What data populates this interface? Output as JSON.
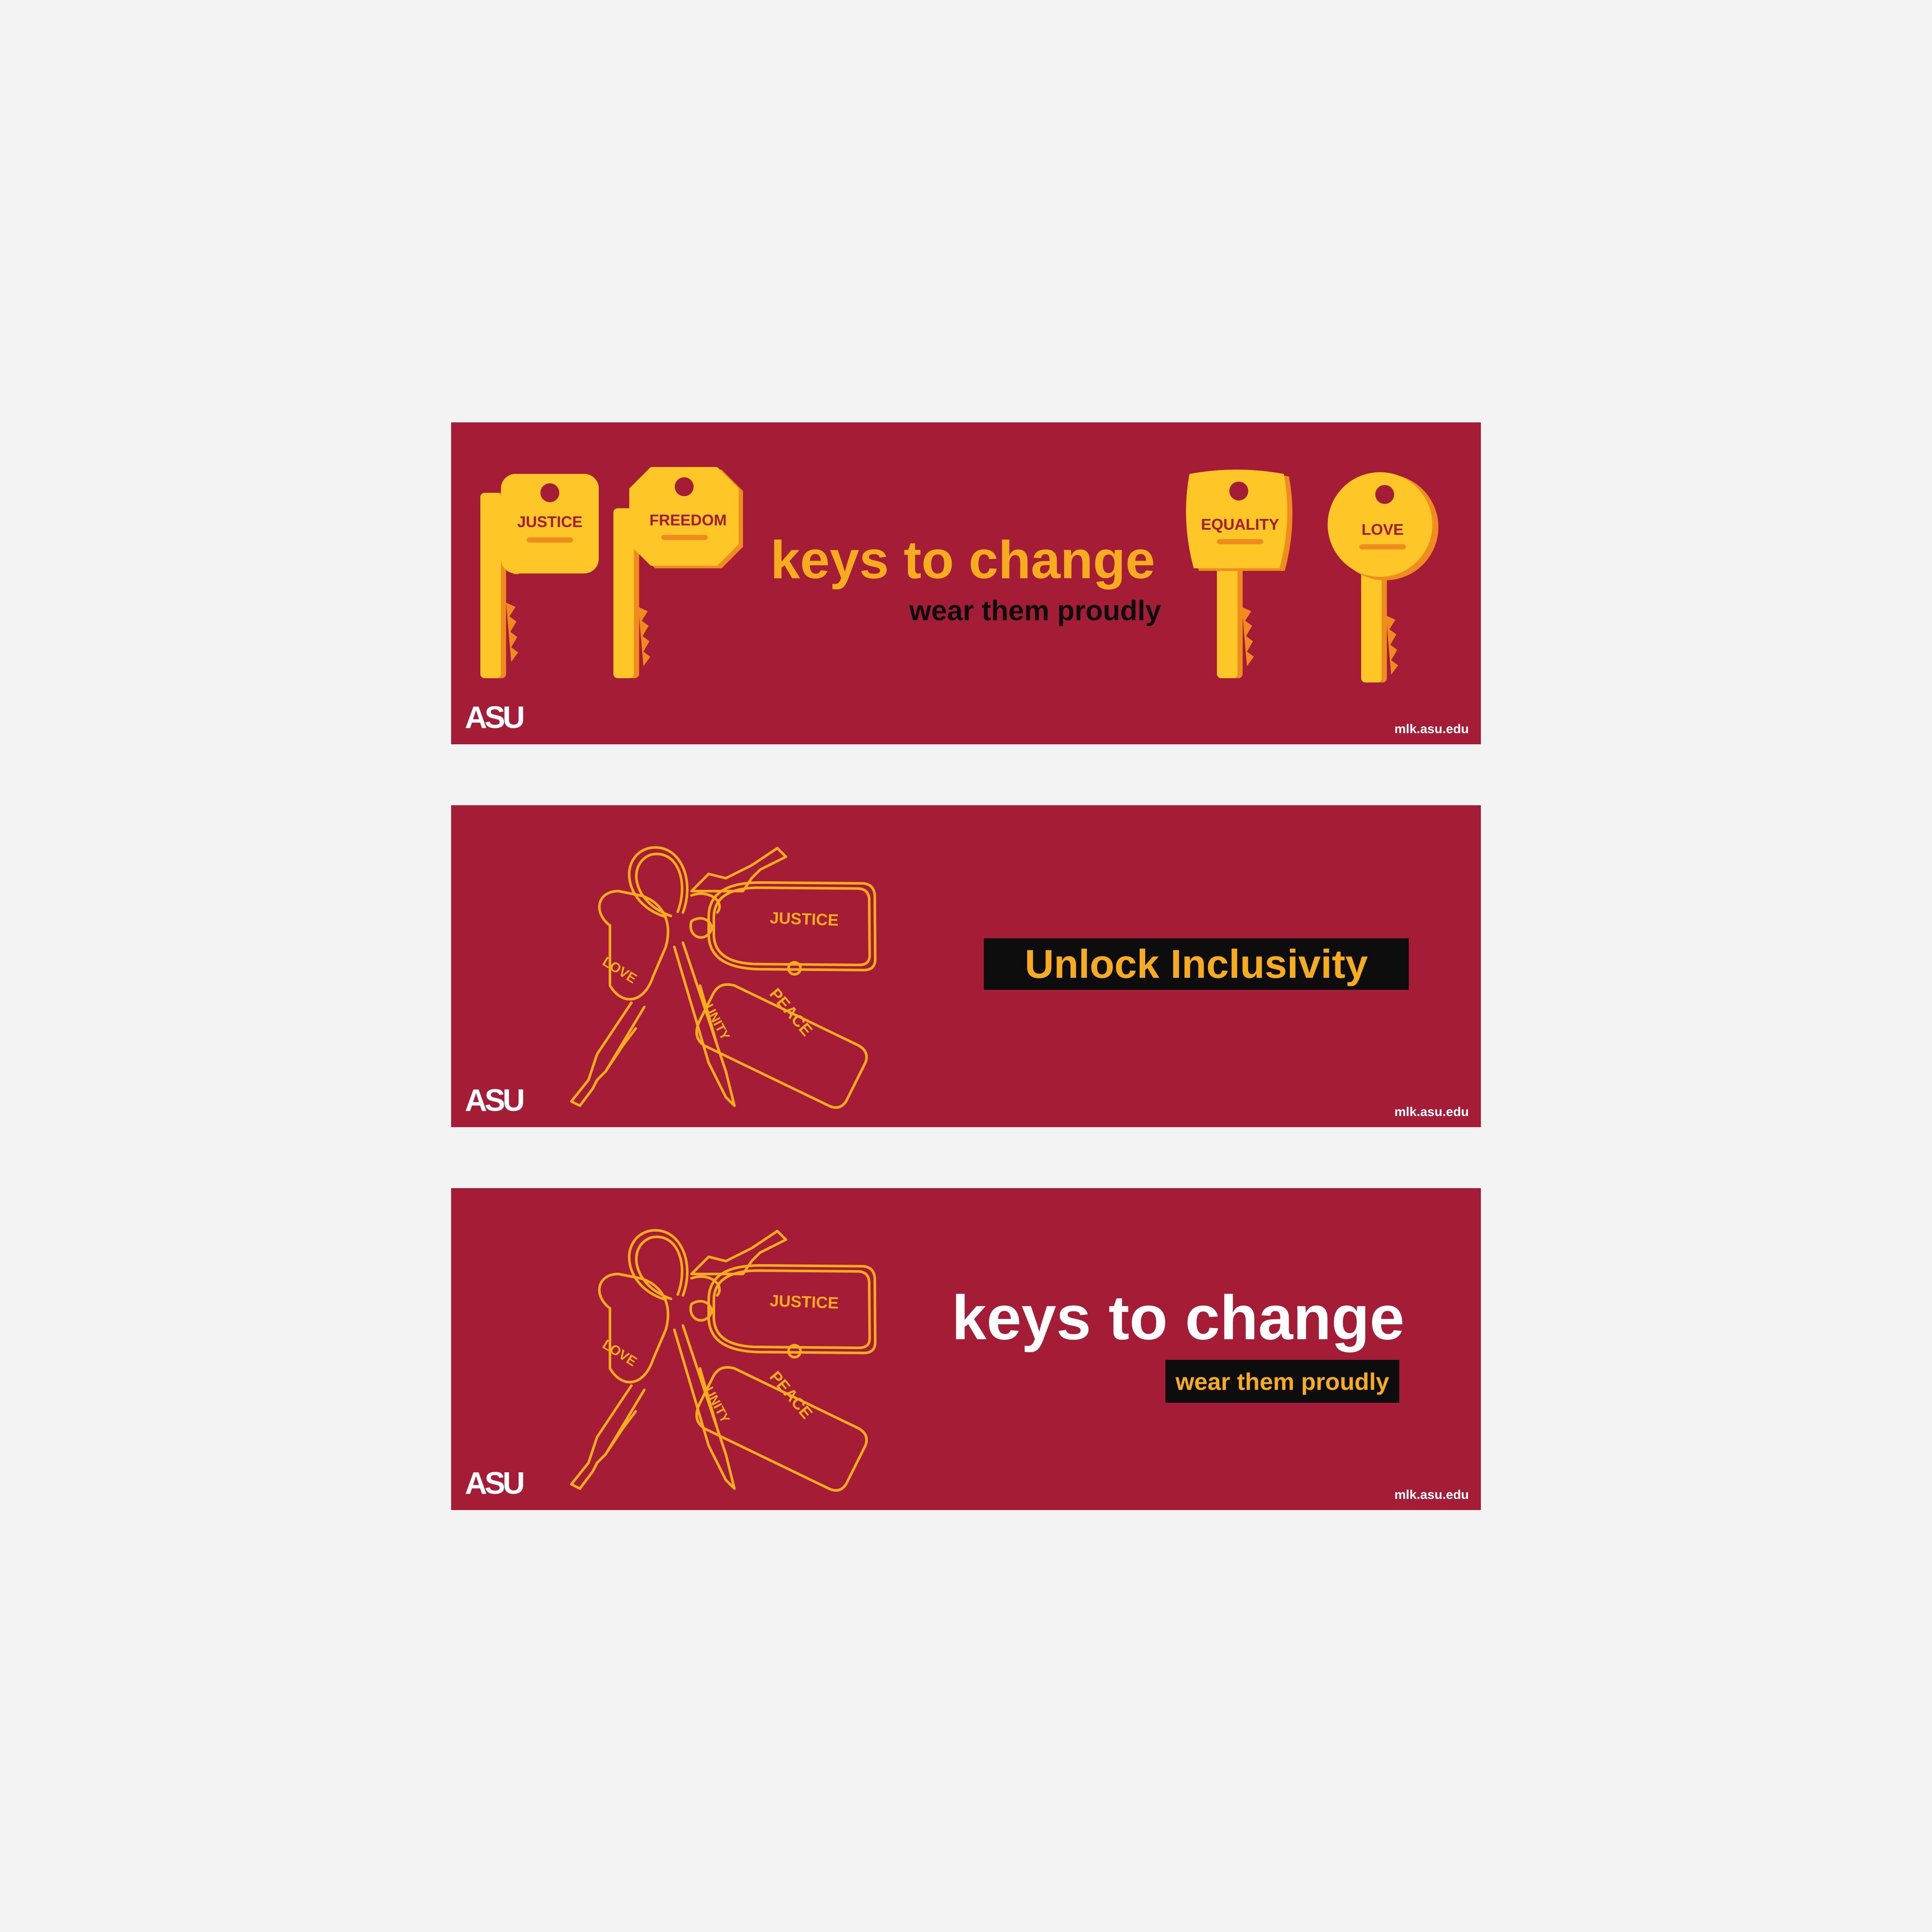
{
  "colors": {
    "maroon": "#a51c37",
    "gold": "#f7ac1f",
    "gold_light": "#ffc627",
    "orange": "#f08c1e",
    "black": "#0d0d0d",
    "white": "#ffffff"
  },
  "banner1": {
    "keys": [
      "JUSTICE",
      "FREEDOM",
      "EQUALITY",
      "LOVE"
    ],
    "title": "keys to change",
    "subtitle": "wear them proudly",
    "logo": "ASU",
    "url": "mlk.asu.edu"
  },
  "banner2": {
    "tags": {
      "justice": "JUSTICE",
      "peace": "PEACE",
      "love": "LOVE",
      "unity": "UNITY"
    },
    "headline": "Unlock Inclusivity",
    "logo": "ASU",
    "url": "mlk.asu.edu"
  },
  "banner3": {
    "tags": {
      "justice": "JUSTICE",
      "peace": "PEACE",
      "love": "LOVE",
      "unity": "UNITY"
    },
    "title": "keys to change",
    "subtitle": "wear them proudly",
    "logo": "ASU",
    "url": "mlk.asu.edu"
  }
}
